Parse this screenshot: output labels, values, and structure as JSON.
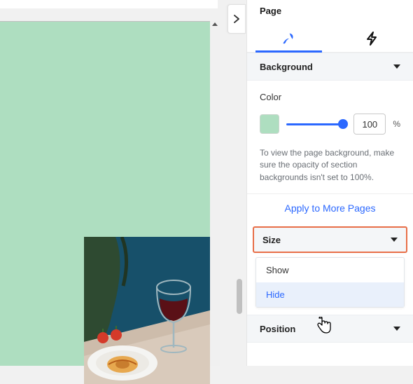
{
  "panel": {
    "title": "Page",
    "tabs": {
      "style": "style",
      "interactions": "interactions"
    }
  },
  "background": {
    "header": "Background",
    "color_label": "Color",
    "swatch_hex": "#aedec0",
    "opacity_value": "100",
    "opacity_unit": "%",
    "hint": "To view the page background, make sure the opacity of section backgrounds isn't set to 100%.",
    "apply_label": "Apply to More Pages"
  },
  "size": {
    "header": "Size",
    "menu": {
      "show": "Show",
      "hide": "Hide"
    }
  },
  "position": {
    "header": "Position"
  }
}
